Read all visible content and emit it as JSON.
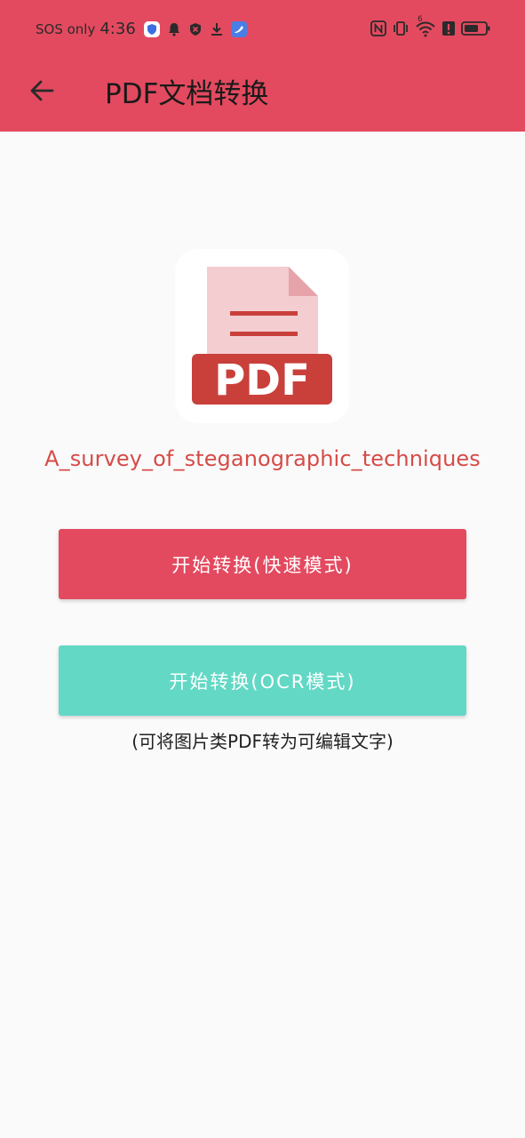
{
  "status_bar": {
    "sos_label": "SOS only",
    "time": "4:36",
    "signal_superscript": "6"
  },
  "header": {
    "title": "PDF文档转换",
    "back_icon": "arrow-left-icon"
  },
  "document": {
    "icon_label": "PDF",
    "filename": "A_survey_of_steganographic_techniques"
  },
  "actions": {
    "fast_convert_label": "开始转换(快速模式)",
    "ocr_convert_label": "开始转换(OCR模式)",
    "ocr_hint": "(可将图片类PDF转为可编辑文字)"
  },
  "colors": {
    "accent": "#e34a5f",
    "ocr_button": "#62d8c5",
    "filename": "#d54b48",
    "pdf_badge": "#c9403b",
    "pdf_page": "#f4cdd1"
  }
}
